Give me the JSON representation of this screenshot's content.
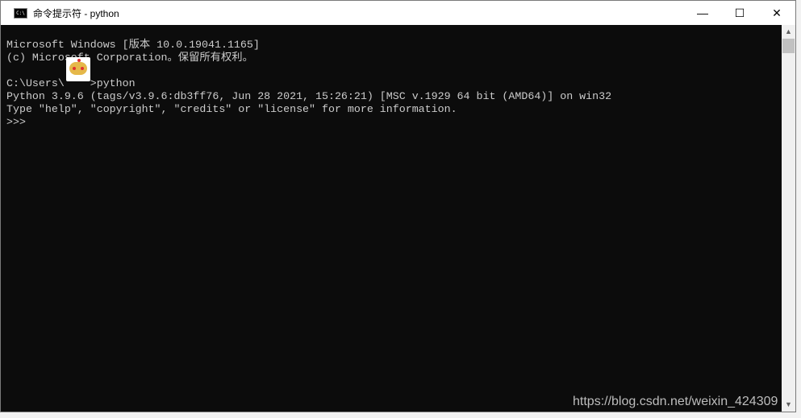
{
  "window": {
    "title": "命令提示符 - python",
    "icon": "cmd-icon"
  },
  "controls": {
    "minimize": "—",
    "maximize": "☐",
    "close": "✕"
  },
  "console": {
    "lines": [
      "Microsoft Windows [版本 10.0.19041.1165]",
      "(c) Microsoft Corporation。保留所有权利。",
      "",
      "C:\\Users\\    >python",
      "Python 3.9.6 (tags/v3.9.6:db3ff76, Jun 28 2021, 15:26:21) [MSC v.1929 64 bit (AMD64)] on win32",
      "Type \"help\", \"copyright\", \"credits\" or \"license\" for more information.",
      ">>>"
    ]
  },
  "watermark": "https://blog.csdn.net/weixin_424309",
  "colors": {
    "console_bg": "#0c0c0c",
    "console_fg": "#cccccc"
  }
}
